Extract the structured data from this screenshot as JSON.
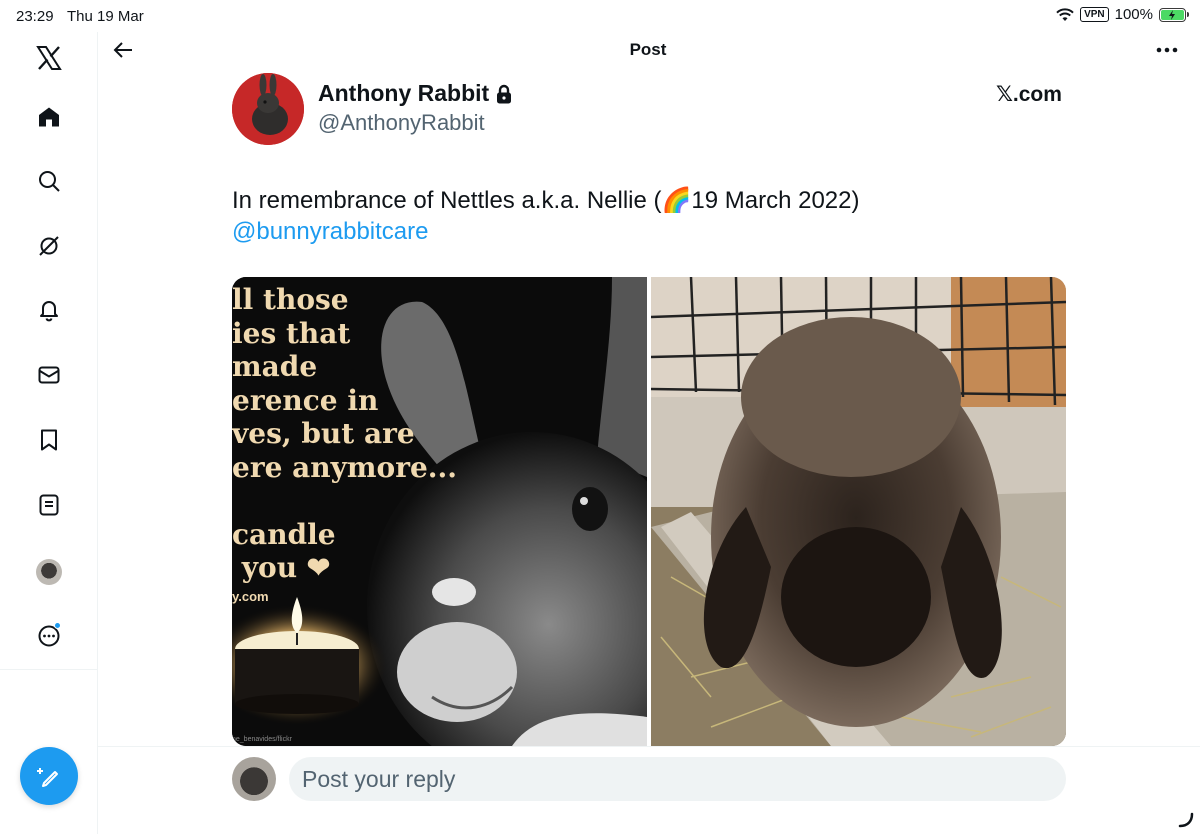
{
  "status_bar": {
    "time": "23:29",
    "date": "Thu 19 Mar",
    "vpn": "VPN",
    "battery": "100%"
  },
  "sidebar": {
    "items": [
      {
        "icon": "x-logo-icon"
      },
      {
        "icon": "home-icon"
      },
      {
        "icon": "search-icon"
      },
      {
        "icon": "grok-icon"
      },
      {
        "icon": "bell-icon"
      },
      {
        "icon": "mail-icon"
      },
      {
        "icon": "bookmark-icon"
      },
      {
        "icon": "lists-icon"
      },
      {
        "icon": "profile-avatar-icon"
      },
      {
        "icon": "more-circle-icon"
      }
    ],
    "compose_icon": "compose-feather-icon",
    "accent": "#1d9bf0"
  },
  "header": {
    "title": "Post"
  },
  "post": {
    "author_name": "Anthony Rabbit",
    "author_handle": "@AnthonyRabbit",
    "source_label": "𝕏.com",
    "text": "In remembrance of Nettles a.k.a. Nellie (🌈19 March 2022)",
    "mention": "@bunnyrabbitcare",
    "image_left": {
      "poem": "ll those\nies that\nmade\nerence in\nves, but are\nere anymore...\n\ncandle\n you ❤",
      "site": "y.com",
      "credit": "ne_benavides/flickr"
    }
  },
  "reply": {
    "placeholder": "Post your reply"
  }
}
